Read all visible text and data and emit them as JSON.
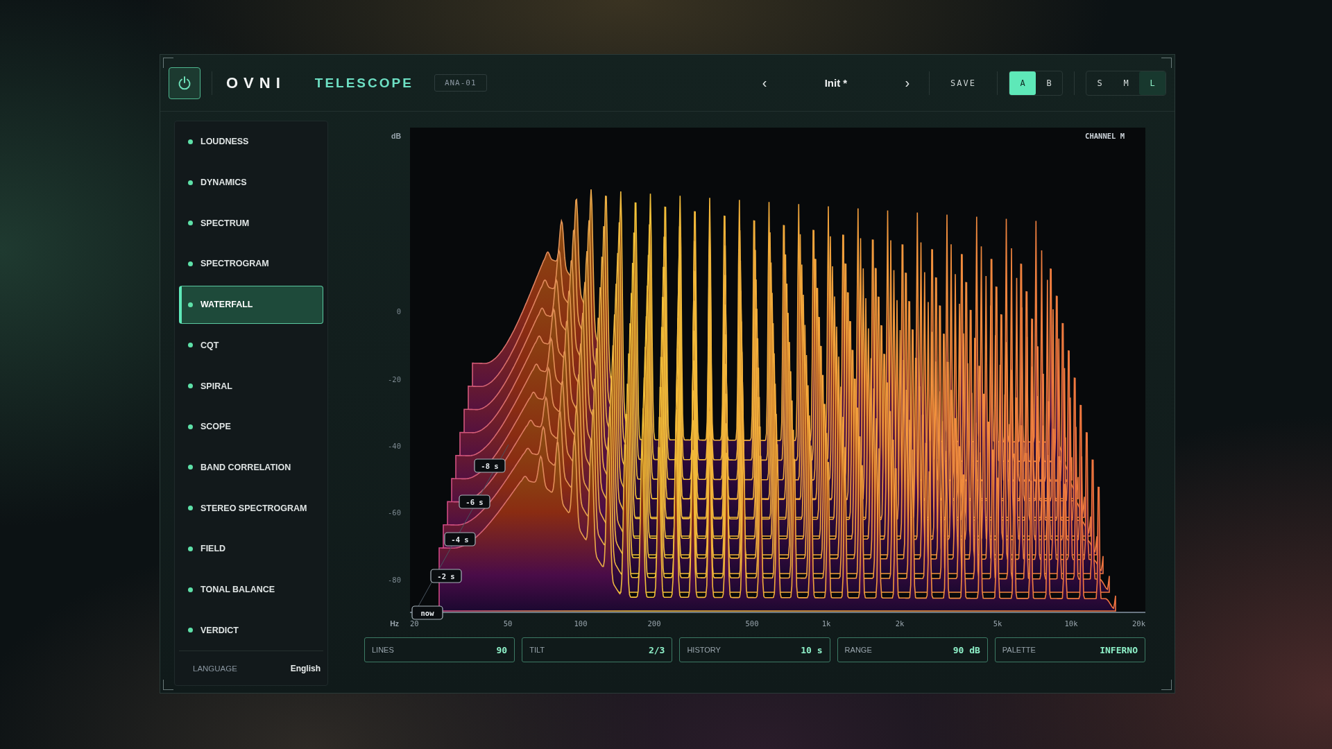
{
  "header": {
    "brand": "OVNI",
    "product": "TELESCOPE",
    "badge": "ANA-01",
    "preset": {
      "prev": "‹",
      "name": "Init *",
      "next": "›"
    },
    "save": "SAVE",
    "ab": [
      {
        "label": "A",
        "selected": true
      },
      {
        "label": "B",
        "selected": false
      }
    ],
    "sizes": [
      {
        "label": "S",
        "selected": false
      },
      {
        "label": "M",
        "selected": false
      },
      {
        "label": "L",
        "selected": true
      }
    ]
  },
  "sidebar": {
    "items": [
      {
        "label": "LOUDNESS",
        "selected": false
      },
      {
        "label": "DYNAMICS",
        "selected": false
      },
      {
        "label": "SPECTRUM",
        "selected": false
      },
      {
        "label": "SPECTROGRAM",
        "selected": false
      },
      {
        "label": "WATERFALL",
        "selected": true
      },
      {
        "label": "CQT",
        "selected": false
      },
      {
        "label": "SPIRAL",
        "selected": false
      },
      {
        "label": "SCOPE",
        "selected": false
      },
      {
        "label": "BAND CORRELATION",
        "selected": false
      },
      {
        "label": "STEREO SPECTROGRAM",
        "selected": false
      },
      {
        "label": "FIELD",
        "selected": false
      },
      {
        "label": "TONAL BALANCE",
        "selected": false
      },
      {
        "label": "VERDICT",
        "selected": false
      }
    ],
    "language": {
      "label": "LANGUAGE",
      "value": "English"
    }
  },
  "chart": {
    "channel": "CHANNEL M",
    "y_unit": "dB",
    "y_labels": [
      "0",
      "-20",
      "-40",
      "-60",
      "-80"
    ],
    "x_unit": "Hz",
    "x_labels": [
      "20",
      "50",
      "100",
      "200",
      "500",
      "1k",
      "2k",
      "5k",
      "10k",
      "20k"
    ],
    "time_labels": [
      "now",
      "-2 s",
      "-4 s",
      "-6 s",
      "-8 s"
    ]
  },
  "params": [
    {
      "label": "LINES",
      "value": "90"
    },
    {
      "label": "TILT",
      "value": "2/3"
    },
    {
      "label": "HISTORY",
      "value": "10 s"
    },
    {
      "label": "RANGE",
      "value": "90 dB"
    },
    {
      "label": "PALETTE",
      "value": "INFERNO"
    }
  ]
}
